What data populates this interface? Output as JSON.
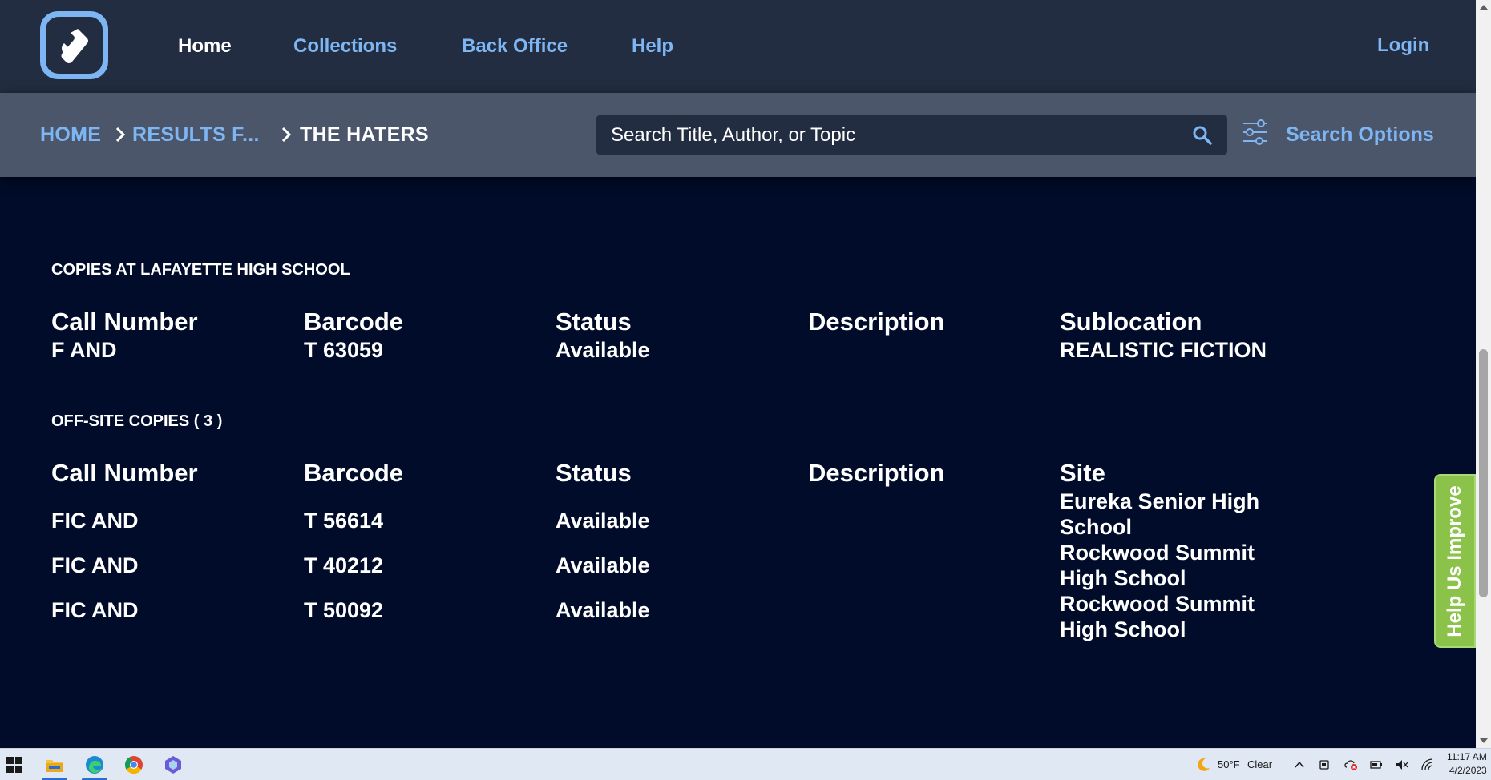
{
  "nav": {
    "links": [
      {
        "label": "Home",
        "active": true
      },
      {
        "label": "Collections"
      },
      {
        "label": "Back Office"
      },
      {
        "label": "Help"
      }
    ],
    "login": "Login"
  },
  "breadcrumb": {
    "items": [
      "HOME",
      "RESULTS F...",
      "THE HATERS"
    ]
  },
  "search": {
    "placeholder": "Search Title, Author, or Topic",
    "options_label": "Search Options"
  },
  "local_copies": {
    "title": "COPIES AT LAFAYETTE HIGH SCHOOL",
    "headers": [
      "Call Number",
      "Barcode",
      "Status",
      "Description",
      "Sublocation"
    ],
    "rows": [
      {
        "call_number": "F AND",
        "barcode": "T 63059",
        "status": "Available",
        "description": "",
        "sublocation": "REALISTIC FICTION"
      }
    ]
  },
  "offsite_copies": {
    "title": "OFF-SITE COPIES ( 3 )",
    "headers": [
      "Call Number",
      "Barcode",
      "Status",
      "Description",
      "Site"
    ],
    "rows": [
      {
        "call_number": "FIC AND",
        "barcode": "T 56614",
        "status": "Available",
        "description": "",
        "site": "Eureka Senior High School"
      },
      {
        "call_number": "FIC AND",
        "barcode": "T 40212",
        "status": "Available",
        "description": "",
        "site": "Rockwood Summit High School"
      },
      {
        "call_number": "FIC AND",
        "barcode": "T 50092",
        "status": "Available",
        "description": "",
        "site": "Rockwood Summit High School"
      }
    ]
  },
  "feedback": {
    "label": "Help Us Improve"
  },
  "colors": {
    "nav_bg": "#222d41",
    "search_band_bg": "#4b566a",
    "page_bg": "#000c2a",
    "link": "#7eb6f4",
    "feedback_green": "#8bc34a"
  },
  "taskbar": {
    "apps": [
      "windows-start-icon",
      "file-explorer-icon",
      "edge-browser-icon",
      "chrome-browser-icon",
      "copilot-app-icon"
    ],
    "weather": {
      "temp": "50°F",
      "condition": "Clear"
    },
    "clock": {
      "time": "11:17 AM",
      "date": "4/2/2023"
    }
  }
}
